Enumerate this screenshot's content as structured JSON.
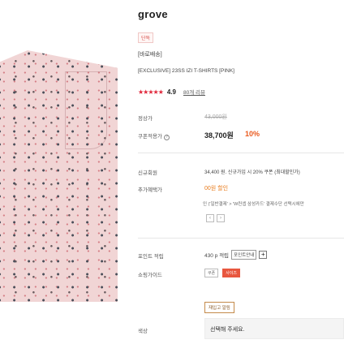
{
  "product": {
    "brand": "grove",
    "badge": "단독",
    "delivery": "[바로배송]",
    "name": "[EXCLUSIVE] 23SS IZI T-SHIRTS [PINK]",
    "rating": {
      "stars": "★★★★★",
      "score": "4.9",
      "review_link": "80개 리뷰"
    }
  },
  "price": {
    "regular_label": "정상가",
    "regular_value": "43,000원",
    "coupon_label": "쿠폰적용가",
    "coupon_value": "38,700원",
    "discount": "10%",
    "help_icon": "?"
  },
  "benefits": {
    "new_member_label": "신규회원",
    "new_member_text": "34,400 원. 신규가입 시 20% 쿠폰 (최대할인가)",
    "extra_label": "추가혜택가",
    "extra_text": "00원 할인",
    "extra_card_text": "인 ('일반결제' > 'W컨셉 삼성카드' 결제수단 선택시에만",
    "arrow_prev": "‹",
    "arrow_next": "›"
  },
  "points": {
    "label": "포인트 적립",
    "value": "430 p 적립",
    "info_button": "포인트안내",
    "plus_button": "+"
  },
  "guide": {
    "label": "쇼핑가이드",
    "btn_a": "쿠폰",
    "btn_b": "사이즈"
  },
  "material_button": "재입고 알림",
  "color": {
    "label": "색상",
    "placeholder": "선택해 주세요."
  },
  "colors": {
    "accent_red": "#e0263a",
    "discount_orange": "#ea5a1e",
    "product_pink": "#f1d5d5"
  }
}
